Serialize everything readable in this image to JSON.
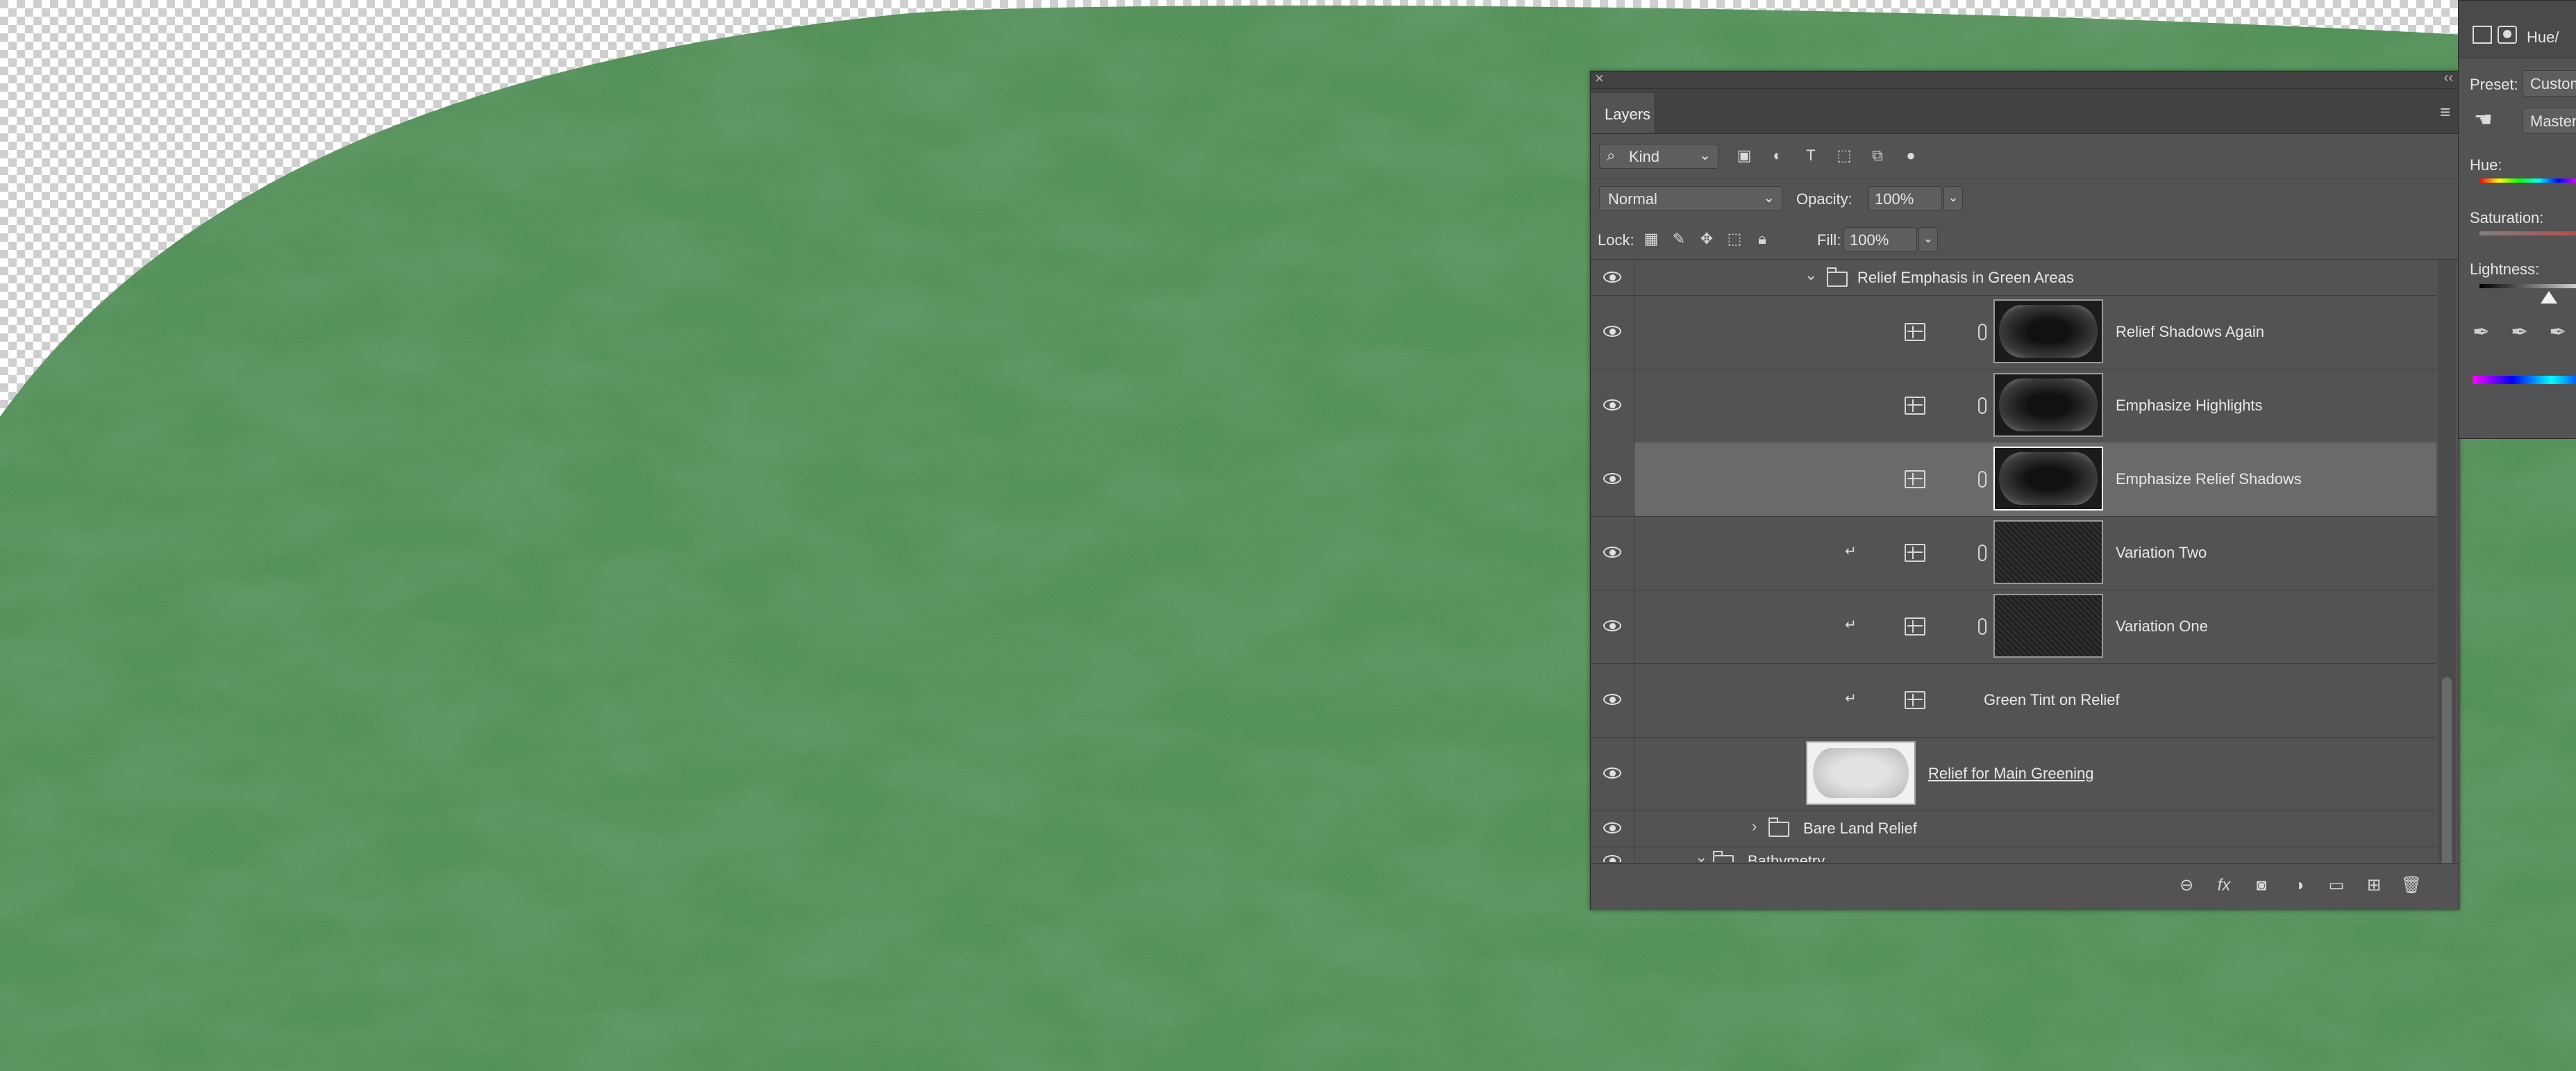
{
  "layers_panel": {
    "tab_label": "Layers",
    "filter": {
      "kind_label": "Kind"
    },
    "blend_mode": "Normal",
    "opacity_label": "Opacity:",
    "opacity_value": "100%",
    "lock_label": "Lock:",
    "fill_label": "Fill:",
    "fill_value": "100%",
    "layers": [
      {
        "name": "Relief Emphasis in Green Areas",
        "kind": "group",
        "expanded": true
      },
      {
        "name": "Relief Shadows Again",
        "kind": "adjustment",
        "clipped": false
      },
      {
        "name": "Emphasize Highlights",
        "kind": "adjustment",
        "clipped": false
      },
      {
        "name": "Emphasize Relief Shadows",
        "kind": "adjustment",
        "clipped": false,
        "selected": true
      },
      {
        "name": "Variation Two",
        "kind": "adjustment",
        "clipped": true
      },
      {
        "name": "Variation One",
        "kind": "adjustment",
        "clipped": true
      },
      {
        "name": "Green Tint on Relief",
        "kind": "adjustment",
        "clipped": true
      },
      {
        "name": "Relief for Main Greening",
        "kind": "pixel",
        "clip_base": true
      },
      {
        "name": "Bare Land Relief",
        "kind": "group",
        "expanded": false
      },
      {
        "name": "Bathymetry",
        "kind": "group",
        "expanded": true
      }
    ]
  },
  "properties_panel": {
    "title": "Hue/",
    "preset_label": "Preset:",
    "preset_value": "Custom",
    "channel_value": "Master",
    "hue_label": "Hue:",
    "saturation_label": "Saturation:",
    "lightness_label": "Lightness:"
  },
  "colors": {
    "canvas_green": "#3f7a44",
    "panel_bg": "#535353",
    "selected_row": "#6a6a6a"
  }
}
